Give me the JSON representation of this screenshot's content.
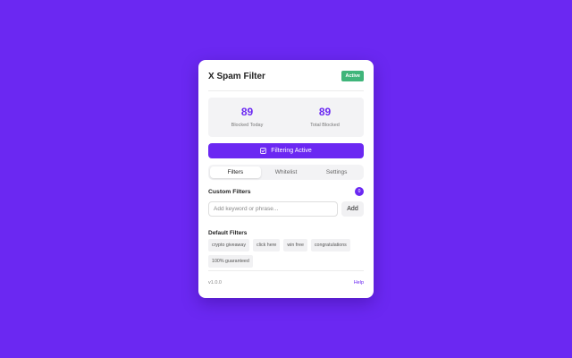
{
  "app": {
    "title": "X Spam Filter",
    "status_badge": "Active",
    "accent_color": "#6b28f2",
    "badge_color": "#3fb57a"
  },
  "stats": {
    "blocked_today": {
      "value": "89",
      "label": "Blocked Today"
    },
    "total_blocked": {
      "value": "89",
      "label": "Total Blocked"
    }
  },
  "filter_toggle": {
    "label": "Filtering Active",
    "icon": "checkbox-icon"
  },
  "tabs": [
    {
      "label": "Filters",
      "active": true
    },
    {
      "label": "Whitelist",
      "active": false
    },
    {
      "label": "Settings",
      "active": false
    }
  ],
  "custom_filters": {
    "title": "Custom Filters",
    "count": "0",
    "input_placeholder": "Add keyword or phrase...",
    "input_value": "",
    "add_label": "Add"
  },
  "default_filters": {
    "title": "Default Filters",
    "items": [
      "crypto giveaway",
      "click here",
      "win free",
      "congratulations",
      "100% guaranteed"
    ]
  },
  "footer": {
    "version": "v1.0.0",
    "help_label": "Help"
  }
}
